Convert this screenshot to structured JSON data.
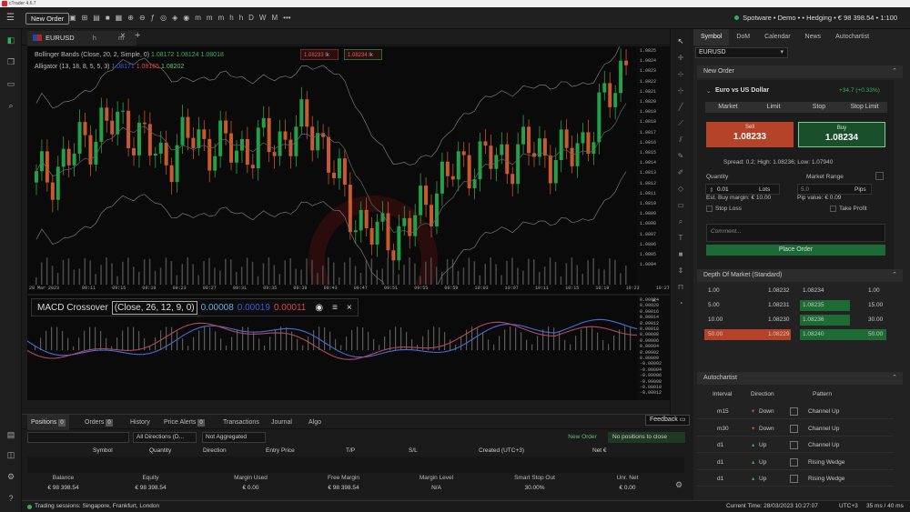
{
  "window": {
    "title": "cTrader 4.6.7"
  },
  "toolbar": {
    "new_order_label": "New Order",
    "timeframes": [
      "m",
      "m",
      "m",
      "h",
      "h",
      "D",
      "W",
      "M"
    ],
    "more": "•••",
    "account": "Spotware • Demo • • Hedging • € 98 398.54 • 1:100"
  },
  "chart_tab": {
    "symbol": "EURUSD",
    "tf": "h",
    "tf2": "m"
  },
  "indicators": {
    "bollinger": {
      "label": "Bollinger Bands (Close, 20, 2, Simple, 0)",
      "v1": "1.08172",
      "v2": "1.08124",
      "v3": "1.08018"
    },
    "alligator": {
      "label": "Alligator (13, 18, 8, 5, 5, 3)",
      "v1": "1.08171",
      "v2": "1.08165",
      "v3": "1.08202"
    }
  },
  "top_quote": {
    "sell": "1.0823",
    "sell_suffix": "3",
    "buy": "1.0823",
    "buy_suffix": "4",
    "lot": "lk"
  },
  "price_axis": [
    "1.0825",
    "1.0824",
    "1.0823",
    "1.0822",
    "1.0821",
    "1.0820",
    "1.0819",
    "1.0818",
    "1.0817",
    "1.0816",
    "1.0815",
    "1.0814",
    "1.0813",
    "1.0812",
    "1.0811",
    "1.0810",
    "1.0809",
    "1.0808",
    "1.0807",
    "1.0806",
    "1.0805",
    "1.0804"
  ],
  "time_axis": [
    "28 Mar 2023",
    "09:11",
    "09:15",
    "09:19",
    "09:23",
    "09:27",
    "09:31",
    "09:35",
    "09:39",
    "09:43",
    "09:47",
    "09:51",
    "09:55",
    "09:59",
    "10:03",
    "10:07",
    "10:11",
    "10:15",
    "10:19",
    "10:23",
    "10:27"
  ],
  "macd": {
    "name": "MACD Crossover",
    "params": "(Close, 26, 12, 9, 0)",
    "v1": "0.00008",
    "v2": "0.00019",
    "v3": "0.00011"
  },
  "macd_axis": [
    "0.00024",
    "0.00020",
    "0.00016",
    "0.00014",
    "0.00012",
    "0.00010",
    "0.00008",
    "0.00006",
    "0.00004",
    "0.00002",
    "0.00000",
    "-0.00002",
    "-0.00004",
    "-0.00006",
    "-0.00008",
    "-0.00010",
    "-0.00012"
  ],
  "panel": {
    "tabs": [
      "Symbol",
      "DoM",
      "Calendar",
      "News",
      "Autochartist"
    ],
    "symbol": "EURUSD",
    "new_order_title": "New Order",
    "instrument": "Euro vs US Dollar",
    "change": "+34.7 (+0.33%)",
    "order_types": [
      "Market",
      "Limit",
      "Stop",
      "Stop Limit"
    ],
    "sell_label": "Sell",
    "buy_label": "Buy",
    "sell_price": "1.08233",
    "buy_price": "1.08234",
    "spread": "Spread: 0.2; High: 1.08236; Low: 1.07940",
    "quantity_label": "Quantity",
    "market_range_label": "Market Range",
    "quantity_value": "0.01",
    "lots": "Lots",
    "range_value": "5.0",
    "pips": "Pips",
    "margin": "Est. Buy margin: € 10.00",
    "pip_value": "Pip value: € 0.09",
    "stop_loss": "Stop Loss",
    "take_profit": "Take Profit",
    "comment_placeholder": "Comment...",
    "place_order": "Place Order",
    "dom_title": "Depth Of Market (Standard)",
    "dom_rows": [
      {
        "lq": "1.00",
        "lp": "1.08232",
        "rp": "1.08234",
        "rq": "1.00"
      },
      {
        "lq": "5.00",
        "lp": "1.08231",
        "rp": "1.08235",
        "rq": "15.00"
      },
      {
        "lq": "10.00",
        "lp": "1.08230",
        "rp": "1.08236",
        "rq": "30.00"
      },
      {
        "lq": "50.00",
        "lp": "1.08229",
        "rp": "1.08240",
        "rq": "50.00"
      }
    ],
    "auto_title": "Autochartist",
    "auto_headers": [
      "Interval",
      "Direction",
      "Pattern"
    ],
    "auto_rows": [
      {
        "interval": "m15",
        "direction": "Down",
        "pattern": "Channel Up"
      },
      {
        "interval": "m30",
        "direction": "Down",
        "pattern": "Channel Up"
      },
      {
        "interval": "d1",
        "direction": "Up",
        "pattern": "Channel Up"
      },
      {
        "interval": "d1",
        "direction": "Up",
        "pattern": "Rising Wedge"
      },
      {
        "interval": "d1",
        "direction": "Up",
        "pattern": "Rising Wedge"
      }
    ]
  },
  "bottom": {
    "tabs": [
      "Positions",
      "Orders",
      "History",
      "Price Alerts",
      "Transactions",
      "Journal",
      "Algo"
    ],
    "positions_badge": "0",
    "orders_badge": "0",
    "alerts_badge": "0",
    "feedback": "Feedback",
    "filter_directions": "All Directions (D...",
    "filter_aggregated": "Not Aggregated",
    "new_order": "New Order",
    "no_positions": "No positions to close",
    "columns": [
      "Symbol",
      "Quantity",
      "Direction",
      "Entry Price",
      "T/P",
      "S/L",
      "Created (UTC+3)",
      "Net €"
    ],
    "summary": [
      {
        "label": "Balance",
        "value": "€ 98 398.54"
      },
      {
        "label": "Equity",
        "value": "€ 98 398.54"
      },
      {
        "label": "Margin Used",
        "value": "€ 0.00"
      },
      {
        "label": "Free Margin",
        "value": "€ 98 398.54"
      },
      {
        "label": "Margin Level",
        "value": "N/A"
      },
      {
        "label": "Smart Stop Out",
        "value": "30.00%"
      },
      {
        "label": "Unr. Net",
        "value": "€ 0.00"
      }
    ]
  },
  "status": {
    "sessions": "Trading sessions: Singapore, Frankfurt, London",
    "time": "Current Time: 28/03/2023 10:27:07",
    "tz": "UTC+3",
    "latency": "35 ms / 40 ms"
  },
  "chart_data": {
    "type": "candlestick",
    "symbol": "EURUSD",
    "ylim": [
      1.0804,
      1.0825
    ],
    "x": [
      "09:11",
      "09:15",
      "09:19",
      "09:23",
      "09:27",
      "09:31",
      "09:35",
      "09:39",
      "09:43",
      "09:47",
      "09:51",
      "09:55",
      "09:59",
      "10:03",
      "10:07",
      "10:11",
      "10:15",
      "10:19",
      "10:23",
      "10:27"
    ],
    "close": [
      1.0813,
      1.0815,
      1.0818,
      1.0818,
      1.0815,
      1.0817,
      1.0816,
      1.0816,
      1.0817,
      1.0818,
      1.0811,
      1.0808,
      1.0809,
      1.0813,
      1.0815,
      1.0815,
      1.0816,
      1.0815,
      1.0818,
      1.0824
    ]
  }
}
